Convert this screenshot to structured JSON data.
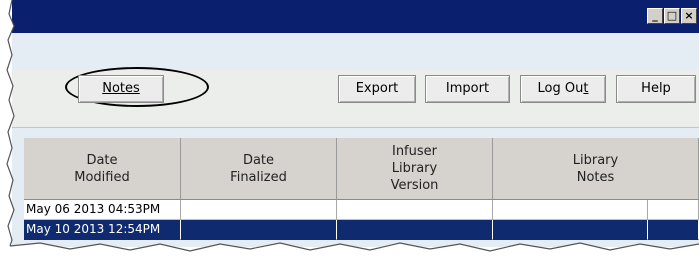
{
  "window": {
    "controls": {
      "minimize": "_",
      "maximize": "□",
      "close": "×"
    }
  },
  "toolbar": {
    "notes": {
      "text": "Notes",
      "underline": "N"
    },
    "export": {
      "text": "Export",
      "underline": "E"
    },
    "import": {
      "text": "Import",
      "underline": "I"
    },
    "logout": {
      "pre": "Log Ou",
      "underline": "t",
      "post": ""
    },
    "help": {
      "text": "Help",
      "underline": "H"
    }
  },
  "table": {
    "headers": [
      "Date\nModified",
      "Date\nFinalized",
      "Infuser\nLibrary\nVersion",
      "Library\nNotes"
    ],
    "rows": [
      {
        "cells": [
          "May 06 2013 04:53PM",
          "",
          "",
          "",
          ""
        ],
        "selected": false
      },
      {
        "cells": [
          "May 10 2013 12:54PM",
          "",
          "",
          "",
          ""
        ],
        "selected": true
      }
    ]
  },
  "colors": {
    "titlebar": "#0a1f6d",
    "selected_row": "#0f2a6e",
    "header_bg": "#d6d3ce"
  }
}
